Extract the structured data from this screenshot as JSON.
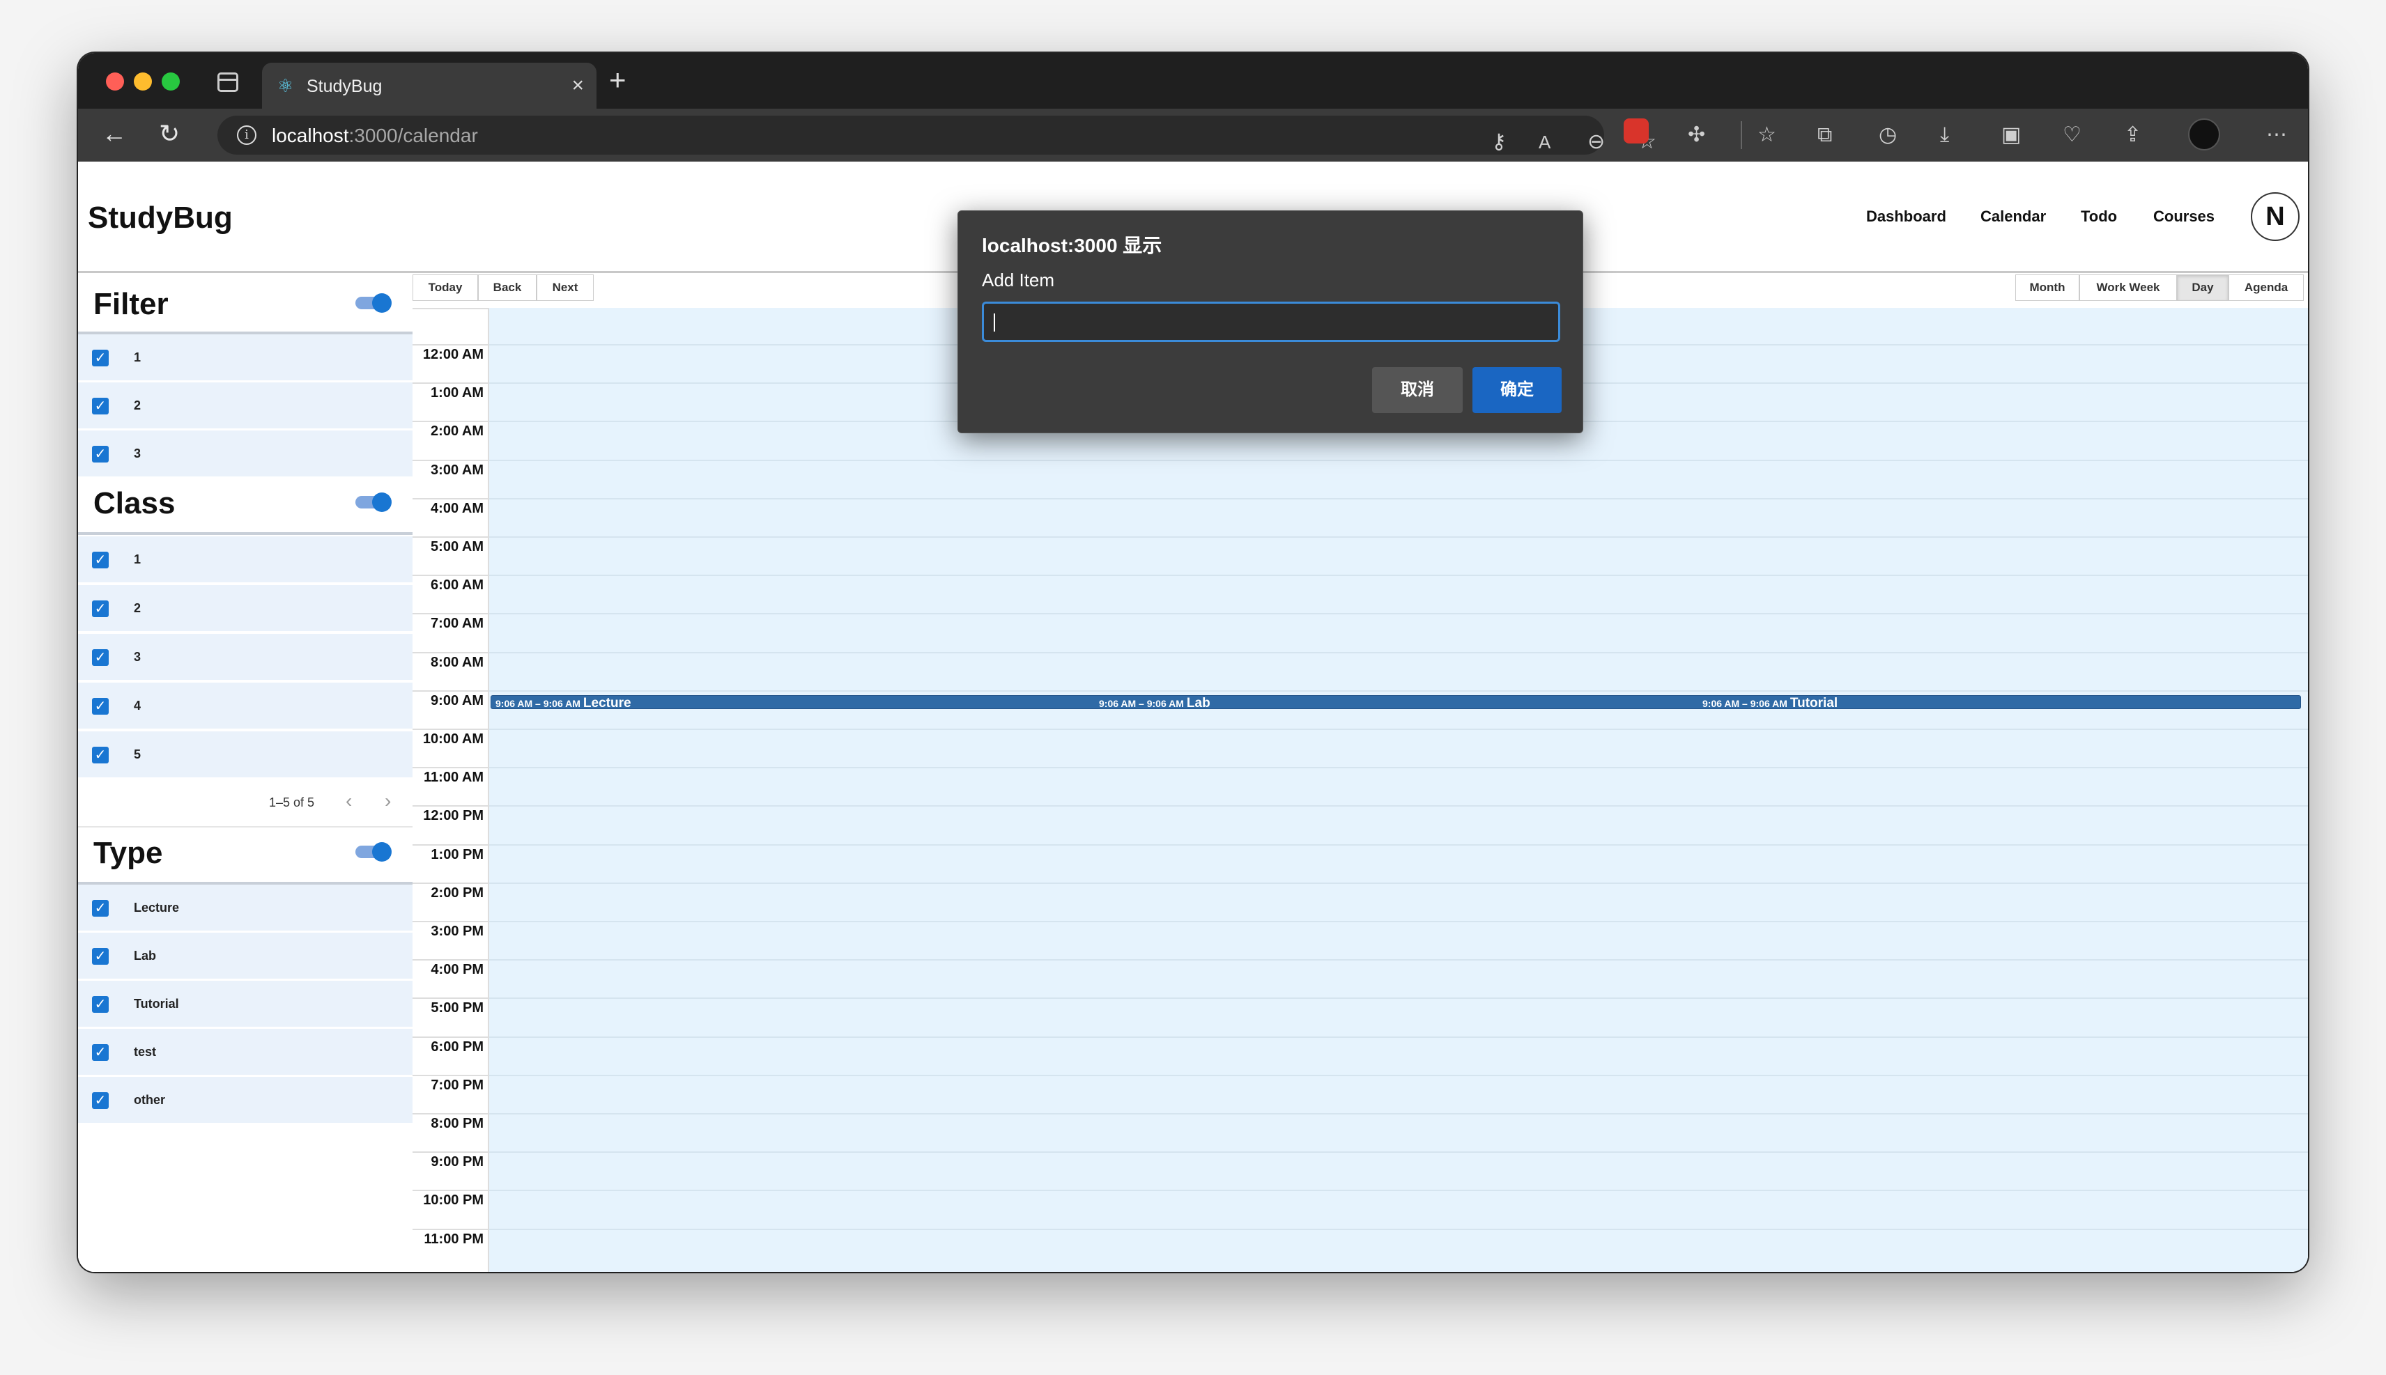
{
  "browser": {
    "tab_title": "StudyBug",
    "url_host": "localhost",
    "url_rest": ":3000/calendar"
  },
  "app": {
    "brand": "StudyBug",
    "nav": [
      "Dashboard",
      "Calendar",
      "Todo",
      "Courses"
    ],
    "avatar": "N"
  },
  "sidebar": {
    "filter": {
      "title": "Filter",
      "enabled": true,
      "items": [
        "1",
        "2",
        "3"
      ]
    },
    "class": {
      "title": "Class",
      "enabled": true,
      "items": [
        "1",
        "2",
        "3",
        "4",
        "5"
      ],
      "pagination": "1–5 of 5"
    },
    "type": {
      "title": "Type",
      "enabled": true,
      "items": [
        "Lecture",
        "Lab",
        "Tutorial",
        "test",
        "other"
      ]
    }
  },
  "calendar": {
    "nav_buttons": [
      "Today",
      "Back",
      "Next"
    ],
    "views": [
      "Month",
      "Work Week",
      "Day",
      "Agenda"
    ],
    "active_view": "Day",
    "hours": [
      "12:00 AM",
      "1:00 AM",
      "2:00 AM",
      "3:00 AM",
      "4:00 AM",
      "5:00 AM",
      "6:00 AM",
      "7:00 AM",
      "8:00 AM",
      "9:00 AM",
      "10:00 AM",
      "11:00 AM",
      "12:00 PM",
      "1:00 PM",
      "2:00 PM",
      "3:00 PM",
      "4:00 PM",
      "5:00 PM",
      "6:00 PM",
      "7:00 PM",
      "8:00 PM",
      "9:00 PM",
      "10:00 PM",
      "11:00 PM"
    ],
    "events": [
      {
        "time": "9:06 AM – 9:06 AM",
        "title": "Lecture"
      },
      {
        "time": "9:06 AM – 9:06 AM",
        "title": "Lab"
      },
      {
        "time": "9:06 AM – 9:06 AM",
        "title": "Tutorial"
      }
    ]
  },
  "dialog": {
    "title": "localhost:3000 显示",
    "message": "Add Item",
    "input_value": "",
    "cancel_label": "取消",
    "ok_label": "确定"
  }
}
